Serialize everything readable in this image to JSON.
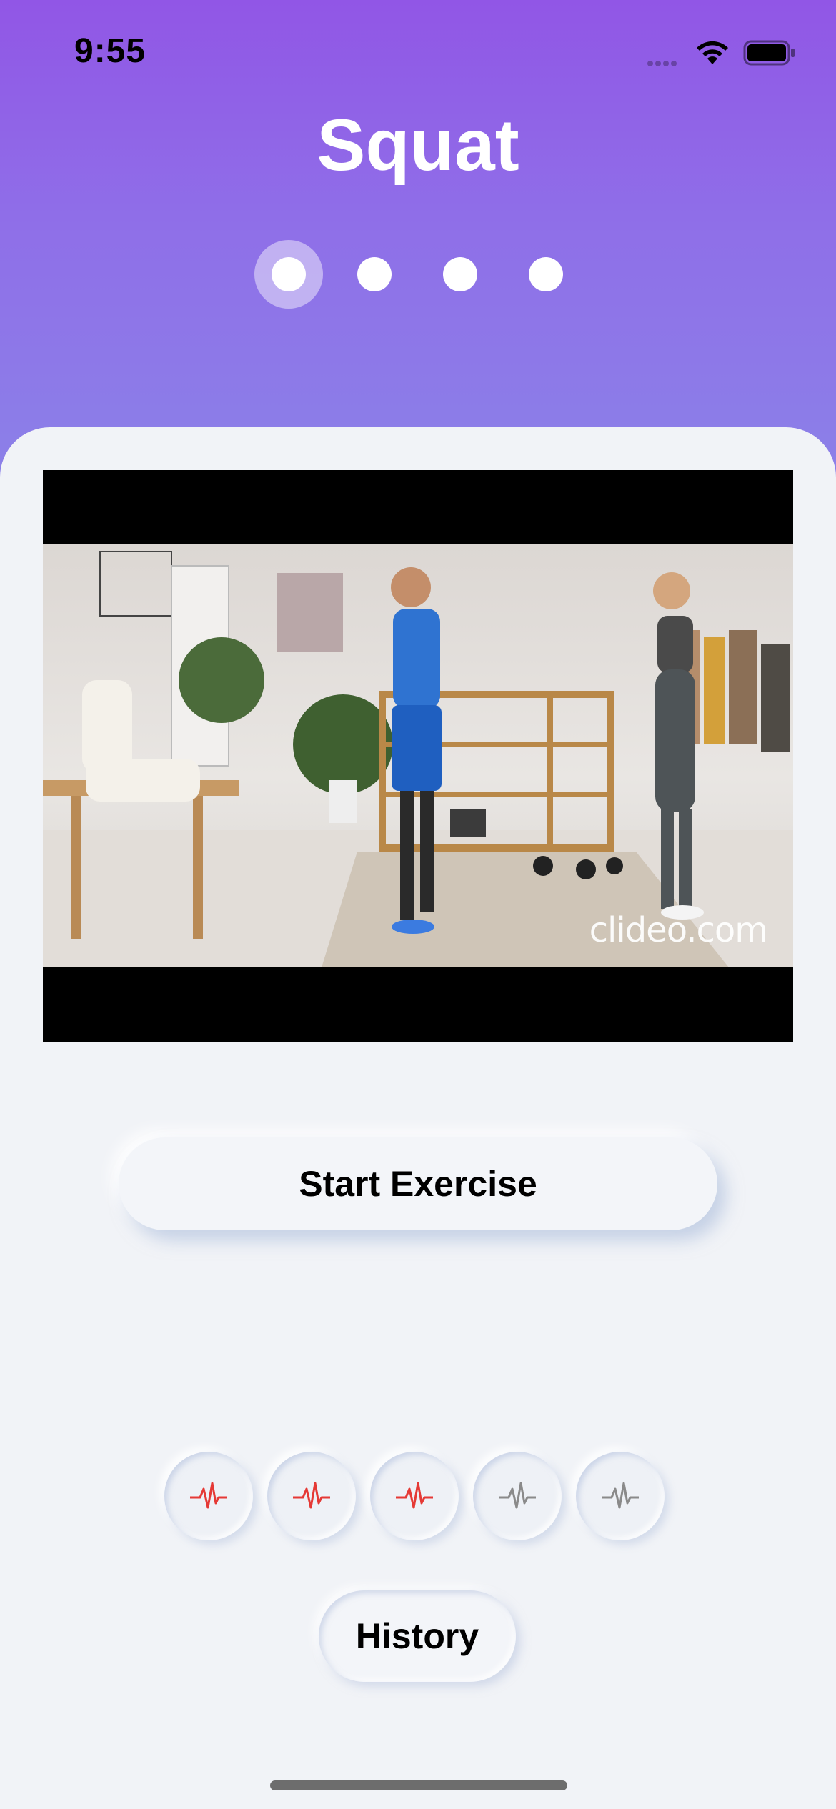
{
  "status_bar": {
    "time": "9:55",
    "icons": [
      "cellular-signal-icon",
      "wifi-icon",
      "battery-icon"
    ]
  },
  "header": {
    "title": "Squat",
    "pager": {
      "count": 4,
      "active_index": 0
    }
  },
  "video": {
    "watermark": "clideo.com"
  },
  "actions": {
    "start_label": "Start Exercise",
    "history_label": "History"
  },
  "heart_rate_indicators": [
    {
      "icon": "heartbeat-icon",
      "state": "active",
      "color": "#e53935"
    },
    {
      "icon": "heartbeat-icon",
      "state": "active",
      "color": "#e53935"
    },
    {
      "icon": "heartbeat-icon",
      "state": "active",
      "color": "#e53935"
    },
    {
      "icon": "heartbeat-icon",
      "state": "inactive",
      "color": "#8a8a8a"
    },
    {
      "icon": "heartbeat-icon",
      "state": "inactive",
      "color": "#8a8a8a"
    }
  ],
  "colors": {
    "header_gradient_top": "#9156e6",
    "header_gradient_bottom": "#8b82e8",
    "background": "#f1f3f7"
  }
}
